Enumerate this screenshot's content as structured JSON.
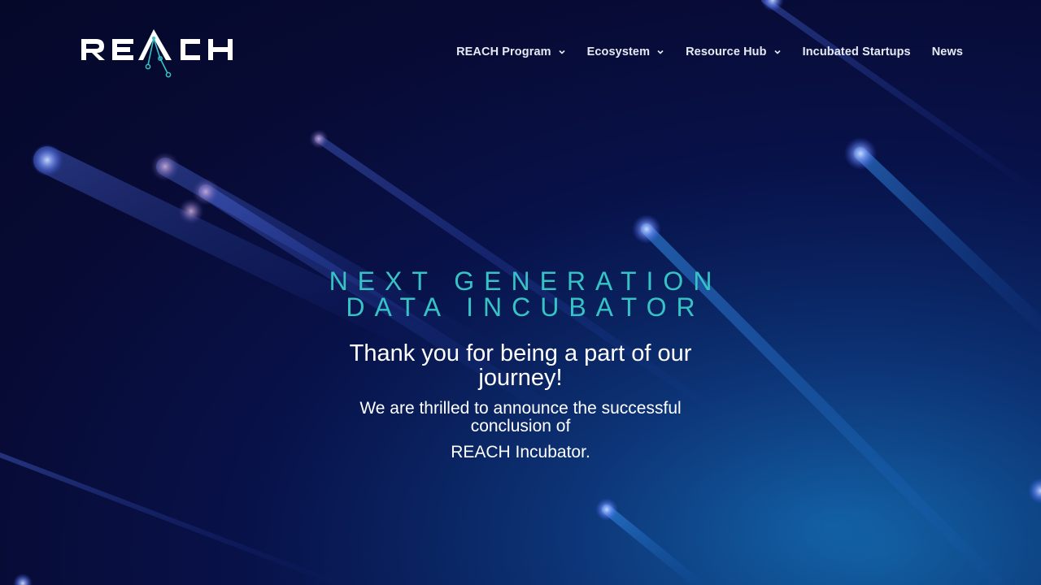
{
  "brand": {
    "logo_text": "REACH",
    "colors": {
      "accent": "#35c3c4",
      "background": "#070a33",
      "text": "#ffffff"
    }
  },
  "nav": {
    "items": [
      {
        "label": "REACH Program",
        "has_dropdown": true
      },
      {
        "label": "Ecosystem",
        "has_dropdown": true
      },
      {
        "label": "Resource Hub",
        "has_dropdown": true
      },
      {
        "label": "Incubated Startups",
        "has_dropdown": false
      },
      {
        "label": "News",
        "has_dropdown": false
      }
    ]
  },
  "hero": {
    "eyebrow_line1": "NEXT GENERATION",
    "eyebrow_line2": "DATA INCUBATOR",
    "headline": "Thank you for being a part of our journey!",
    "sub_line1": "We are thrilled to announce the successful conclusion of",
    "sub_line2": "REACH Incubator."
  }
}
